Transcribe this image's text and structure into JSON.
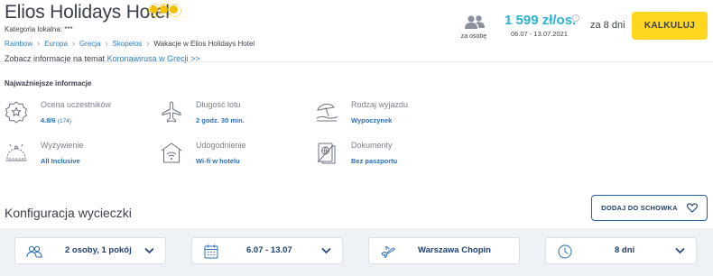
{
  "header": {
    "hotel_name": "Elios Holidays Hotel",
    "local_category": "Kategoria lokalna: ***",
    "breadcrumb": [
      "Rainbow",
      "Europa",
      "Grecja",
      "Skopelos"
    ],
    "breadcrumb_current": "Wakacje w Elios Holidays Hotel",
    "covid_text": "Zobacz informacje na temat",
    "covid_link": "Koronawirusa w Grecji >>"
  },
  "price_box": {
    "persons_icon": "two-persons-icon",
    "per_person_label": "za osobę",
    "price": "1 599 zł/os.",
    "info_symbol": "i",
    "dates": "06.07 - 13.07.2021",
    "nights": "za 8 dni",
    "calc_button": "KALKULUJ"
  },
  "info": {
    "title": "Najważniejsze informacje",
    "items": [
      {
        "icon": "badge-star-icon",
        "label": "Ocena uczestników",
        "value": "4.8/6",
        "sub": "(174)"
      },
      {
        "icon": "airplane-icon",
        "label": "Długość lotu",
        "value": "2 godz. 30 min.",
        "sub": ""
      },
      {
        "icon": "beach-umbrella-icon",
        "label": "Rodzaj wyjazdu",
        "value": "Wypoczynek",
        "sub": ""
      },
      {
        "icon": "food-cloche-icon",
        "label": "Wyżywienie",
        "value": "All Inclusive",
        "sub": ""
      },
      {
        "icon": "wifi-house-icon",
        "label": "Udogodnienie",
        "value": "Wi-fi w hotelu",
        "sub": ""
      },
      {
        "icon": "passport-icon",
        "label": "Dokumenty",
        "value": "Bez paszportu",
        "sub": ""
      }
    ]
  },
  "config": {
    "title": "Konfiguracja wycieczki",
    "clipboard_button": "DODAJ DO SCHOWKA",
    "fields": [
      {
        "icon": "people-icon",
        "value": "2 osoby, 1 pokój"
      },
      {
        "icon": "calendar-icon",
        "value": "6.07 - 13.07"
      },
      {
        "icon": "plane-departure-icon",
        "value": "Warszawa Chopin"
      },
      {
        "icon": "clock-icon",
        "value": "8 dni"
      }
    ]
  },
  "colors": {
    "accent_yellow": "#ffd61f",
    "price_blue": "#2cb3d2",
    "link_blue": "#2a7fc0",
    "dark_navy": "#1f3f70",
    "star_gold": "#f5c000"
  }
}
